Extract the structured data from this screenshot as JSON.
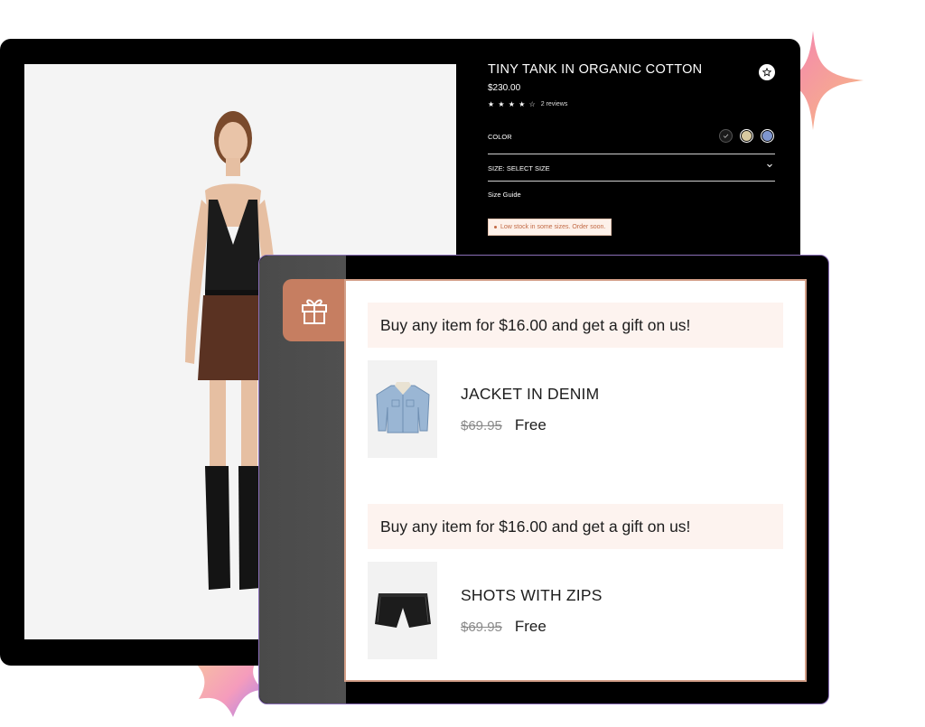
{
  "product": {
    "title": "TINY TANK IN ORGANIC COTTON",
    "price": "$230.00",
    "rating": 4.5,
    "stars": "★ ★ ★ ★ ☆",
    "reviews": "2 reviews",
    "color_label": "COLOR",
    "swatches": [
      "#1a1a1a",
      "#d8c9a0",
      "#7f96cf"
    ],
    "size_label": "SIZE: SELECT SIZE",
    "size_guide": "Size Guide",
    "stock_note": "Low stock in some sizes. Order soon."
  },
  "gift_popup": {
    "offers": [
      {
        "banner": "Buy any item for $16.00 and get a gift on us!",
        "item_name": "JACKET IN DENIM",
        "old_price": "$69.95",
        "new_price": "Free"
      },
      {
        "banner": "Buy any item for $16.00 and get a gift on us!",
        "item_name": "SHOTS WITH ZIPS",
        "old_price": "$69.95",
        "new_price": "Free"
      }
    ]
  },
  "colors": {
    "accent": "#c67e61",
    "banner_bg": "#fdf3ef",
    "window_bg": "#000000"
  }
}
